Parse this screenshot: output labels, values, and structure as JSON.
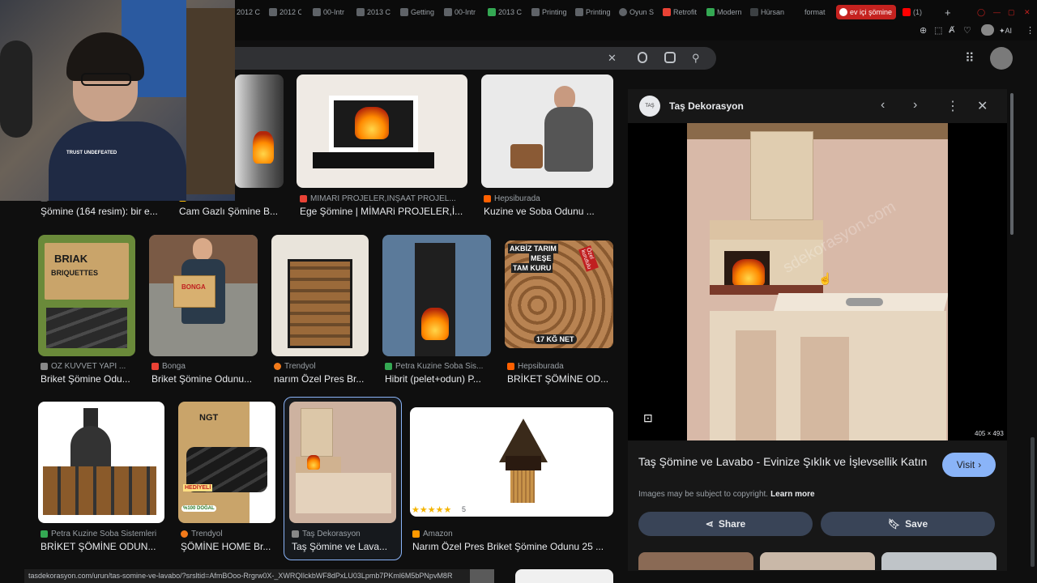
{
  "browser": {
    "tabs": [
      {
        "label": "2012 C"
      },
      {
        "label": "2012 C"
      },
      {
        "label": "00-Intr"
      },
      {
        "label": "2013 C"
      },
      {
        "label": "Getting"
      },
      {
        "label": "00-Intr"
      },
      {
        "label": "2013 C"
      },
      {
        "label": "Printing"
      },
      {
        "label": "Printing"
      },
      {
        "label": "Oyun S"
      },
      {
        "label": "Retrofit"
      },
      {
        "label": "Modern"
      },
      {
        "label": "Hürsan"
      },
      {
        "label": "format"
      },
      {
        "label": "ev içi şömine"
      },
      {
        "label": "(1)"
      }
    ],
    "new_tab": "+",
    "toolbar_ai": "AI"
  },
  "search": {
    "clear_icon": "✕",
    "mic_icon": "mic",
    "lens_icon": "lens",
    "search_icon": "search",
    "apps_icon": "apps"
  },
  "results": {
    "row1": [
      {
        "source": "",
        "title": "Şömine (164 resim): bir e..."
      },
      {
        "source": "",
        "title": "Cam Gazlı Şömine B..."
      },
      {
        "source": "MİMARİ PROJELER,İNŞAAT PROJEL...",
        "title": "Ege Şömine | MİMARi PROJELER,İ..."
      },
      {
        "source": "Hepsiburada",
        "title": "Kuzine ve Soba Odunu ..."
      }
    ],
    "row2": [
      {
        "source": "OZ KUVVET YAPI ...",
        "title": "Briket Şömine Odu..."
      },
      {
        "source": "Bonga",
        "title": "Briket Şömine Odunu..."
      },
      {
        "source": "Trendyol",
        "title": "narım Özel Pres Br..."
      },
      {
        "source": "Petra Kuzine Soba Sis...",
        "title": "Hibrit (pelet+odun) P..."
      },
      {
        "source": "Hepsiburada",
        "title": "BRİKET ŞÖMİNE OD..."
      }
    ],
    "row3": [
      {
        "source": "Petra Kuzine Soba Sistemleri",
        "title": "BRİKET ŞÖMİNE ODUN..."
      },
      {
        "source": "Trendyol",
        "title": "ŞÖMİNE HOME Br..."
      },
      {
        "source": "Taş Dekorasyon",
        "title": "Taş Şömine ve Lava..."
      },
      {
        "source": "Amazon",
        "title": "Narım Özel Pres Briket Şömine Odunu 25 ..."
      }
    ],
    "img_texts": {
      "briquettes_brand": "BRIAK",
      "briquettes_label": "BRIQUETTES",
      "bonga_box": "BONGA",
      "akbiz_line1": "AKBİZ TARIM",
      "akbiz_line2": "MEŞE",
      "akbiz_line3": "TAM KURU",
      "akbiz_badge": "Özel kurutulu",
      "akbiz_weight": "17 KĞ NET",
      "amazon_rating": "5",
      "ngt_brand": "NGT",
      "ngt_gift": "HEDİYELİ",
      "ngt_natural": "%100 DOĞAL"
    }
  },
  "panel": {
    "site_name": "Taş Dekorasyon",
    "logo_text": "TAŞ",
    "title": "Taş Şömine ve Lavabo - Evinize Şıklık ve İşlevsellik Katın",
    "visit_label": "Visit",
    "copyright": "Images may be subject to copyright.",
    "learn_more": "Learn more",
    "share_label": "Share",
    "save_label": "Save",
    "dimensions": "405 × 493",
    "watermark": "sdekorasyon.com"
  },
  "status_url": "tasdekorasyon.com/urun/tas-somine-ve-lavabo/?srsltid=AfmBOoo-Rrgrw0X-_XWRQIlckbWF8dPxLU03Lpmb7PKml6M5bPNpvM8R",
  "webcam": {
    "shirt_text": "TRUST UNDEFEATED"
  },
  "colors": {
    "accent": "#8ab4f8",
    "active_tab": "#c5221f",
    "pill": "#394457",
    "background": "#0f0f0f"
  }
}
